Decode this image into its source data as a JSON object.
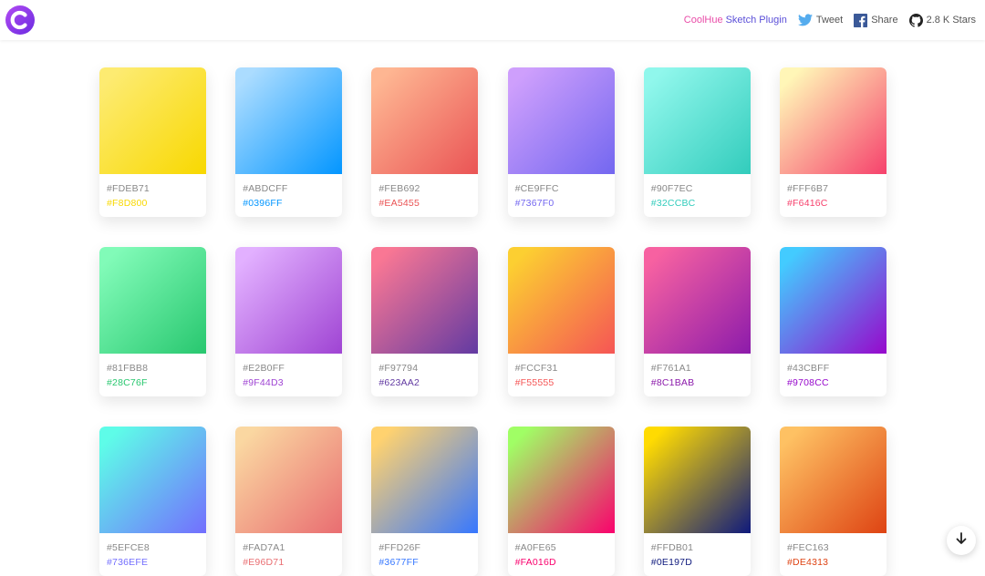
{
  "header": {
    "plugin_prefix": "CoolHue",
    "plugin_rest": "Sketch Plugin",
    "tweet_label": "Tweet",
    "share_label": "Share",
    "stars_label": "2.8 K Stars",
    "icons": [
      "coolhue-logo-icon",
      "twitter-bird-icon",
      "facebook-icon",
      "github-icon"
    ]
  },
  "gradients": [
    {
      "start": "#FDEB71",
      "end": "#F8D800"
    },
    {
      "start": "#ABDCFF",
      "end": "#0396FF"
    },
    {
      "start": "#FEB692",
      "end": "#EA5455"
    },
    {
      "start": "#CE9FFC",
      "end": "#7367F0"
    },
    {
      "start": "#90F7EC",
      "end": "#32CCBC"
    },
    {
      "start": "#FFF6B7",
      "end": "#F6416C"
    },
    {
      "start": "#81FBB8",
      "end": "#28C76F"
    },
    {
      "start": "#E2B0FF",
      "end": "#9F44D3"
    },
    {
      "start": "#F97794",
      "end": "#623AA2"
    },
    {
      "start": "#FCCF31",
      "end": "#F55555"
    },
    {
      "start": "#F761A1",
      "end": "#8C1BAB"
    },
    {
      "start": "#43CBFF",
      "end": "#9708CC"
    },
    {
      "start": "#5EFCE8",
      "end": "#736EFE"
    },
    {
      "start": "#FAD7A1",
      "end": "#E96D71"
    },
    {
      "start": "#FFD26F",
      "end": "#3677FF"
    },
    {
      "start": "#A0FE65",
      "end": "#FA016D"
    },
    {
      "start": "#FFDB01",
      "end": "#0E197D"
    },
    {
      "start": "#FEC163",
      "end": "#DE4313"
    }
  ],
  "scroll_button": {
    "icon": "arrow-down-icon"
  }
}
